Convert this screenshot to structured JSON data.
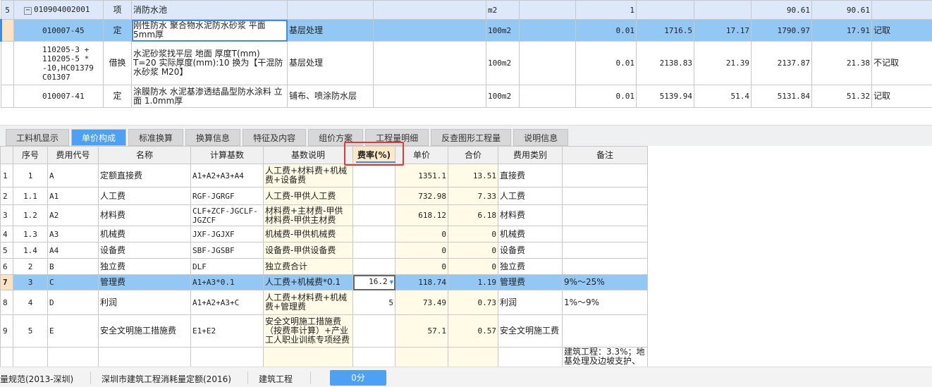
{
  "top_table": {
    "rows": [
      {
        "rownum": "5",
        "code": "010904002001",
        "type": "项",
        "name": "消防水池",
        "feature": "",
        "unit": "m2",
        "expr": "",
        "qty": "1",
        "c1": "",
        "c2": "",
        "c3": "90.61",
        "c4": "90.61",
        "note": ""
      },
      {
        "rownum": "",
        "code": "010007-45",
        "type": "定",
        "name": "刚性防水 聚合物水泥防水砂浆 平面 5mm厚",
        "feature": "基层处理",
        "unit": "100m2",
        "expr": "",
        "qty": "0.01",
        "c1": "1716.5",
        "c2": "17.17",
        "c3": "1790.97",
        "c4": "17.91",
        "note": "记取"
      },
      {
        "rownum": "",
        "code": "110205-3 + 110205-5 * -10,HC01379 C01307",
        "type": "借换",
        "name": "水泥砂浆找平层 地面 厚度T(mm) T=20 实际厚度(mm):10 换为【干混防水砂浆 M20】",
        "feature": "基层处理",
        "unit": "100m2",
        "expr": "",
        "qty": "0.01",
        "c1": "2138.83",
        "c2": "21.39",
        "c3": "2137.87",
        "c4": "21.38",
        "note": "不记取"
      },
      {
        "rownum": "",
        "code": "010007-41",
        "type": "定",
        "name": "涂膜防水 水泥基渗透结晶型防水涂料 立面 1.0mm厚",
        "feature": "铺布、喷涂防水层",
        "unit": "100m2",
        "expr": "",
        "qty": "0.01",
        "c1": "5139.94",
        "c2": "51.4",
        "c3": "5131.84",
        "c4": "51.32",
        "note": "记取"
      }
    ]
  },
  "tabs": [
    "工料机显示",
    "单价构成",
    "标准换算",
    "换算信息",
    "特征及内容",
    "组价方案",
    "工程量明细",
    "反查图形工程量",
    "说明信息"
  ],
  "active_tab": "单价构成",
  "cost_table": {
    "headers": [
      "",
      "序号",
      "费用代号",
      "名称",
      "计算基数",
      "基数说明",
      "费率(%)",
      "单价",
      "合价",
      "费用类别",
      "备注"
    ],
    "rows": [
      [
        "1",
        "1",
        "A",
        "定额直接费",
        "A1+A2+A3+A4",
        "人工费+材料费+机械费+设备费",
        "",
        "1351.1",
        "13.51",
        "直接费",
        ""
      ],
      [
        "2",
        "1.1",
        "A1",
        "人工费",
        "RGF-JGRGF",
        "人工费-甲供人工费",
        "",
        "732.98",
        "7.33",
        "人工费",
        ""
      ],
      [
        "3",
        "1.2",
        "A2",
        "材料费",
        "CLF+ZCF-JGCLF-JGZCF",
        "材料费+主材费-甲供材料费-甲供主材费",
        "",
        "618.12",
        "6.18",
        "材料费",
        ""
      ],
      [
        "4",
        "1.3",
        "A3",
        "机械费",
        "JXF-JGJXF",
        "机械费-甲供机械费",
        "",
        "0",
        "0",
        "机械费",
        ""
      ],
      [
        "5",
        "1.4",
        "A4",
        "设备费",
        "SBF-JGSBF",
        "设备费-甲供设备费",
        "",
        "0",
        "0",
        "设备费",
        ""
      ],
      [
        "6",
        "2",
        "B",
        "独立费",
        "DLF",
        "独立费合计",
        "",
        "0",
        "0",
        "独立费",
        ""
      ],
      [
        "7",
        "3",
        "C",
        "管理费",
        "A1+A3*0.1",
        "人工费+机械费*0.1",
        "16.2",
        "118.74",
        "1.19",
        "管理费",
        "9%～25%"
      ],
      [
        "8",
        "4",
        "D",
        "利润",
        "A1+A2+A3+C",
        "人工费+材料费+机械费+管理费",
        "5",
        "73.49",
        "0.73",
        "利润",
        "1%～9%"
      ],
      [
        "9",
        "5",
        "E",
        "安全文明施工措施费",
        "E1+E2",
        "安全文明施工措施费（按费率计算）+产业工人职业训练专项经费",
        "",
        "57.1",
        "0.57",
        "安全文明施工费",
        ""
      ],
      [
        "",
        "",
        "",
        "",
        "",
        "",
        "",
        "",
        "",
        "",
        "建筑工程：3.3%；地基处理及边坡支护、"
      ]
    ],
    "selected_row": 7
  },
  "status": {
    "spec": "量规范(2013-深圳)",
    "quota": "深圳市建筑工程消耗量定额(2016)",
    "type": "建筑工程",
    "score": "0分"
  },
  "colors": {
    "accent": "#4da1f4",
    "selected_row": "#93c8f5",
    "highlight_box": "#e53935",
    "yellow_col": "#fffbe6"
  }
}
